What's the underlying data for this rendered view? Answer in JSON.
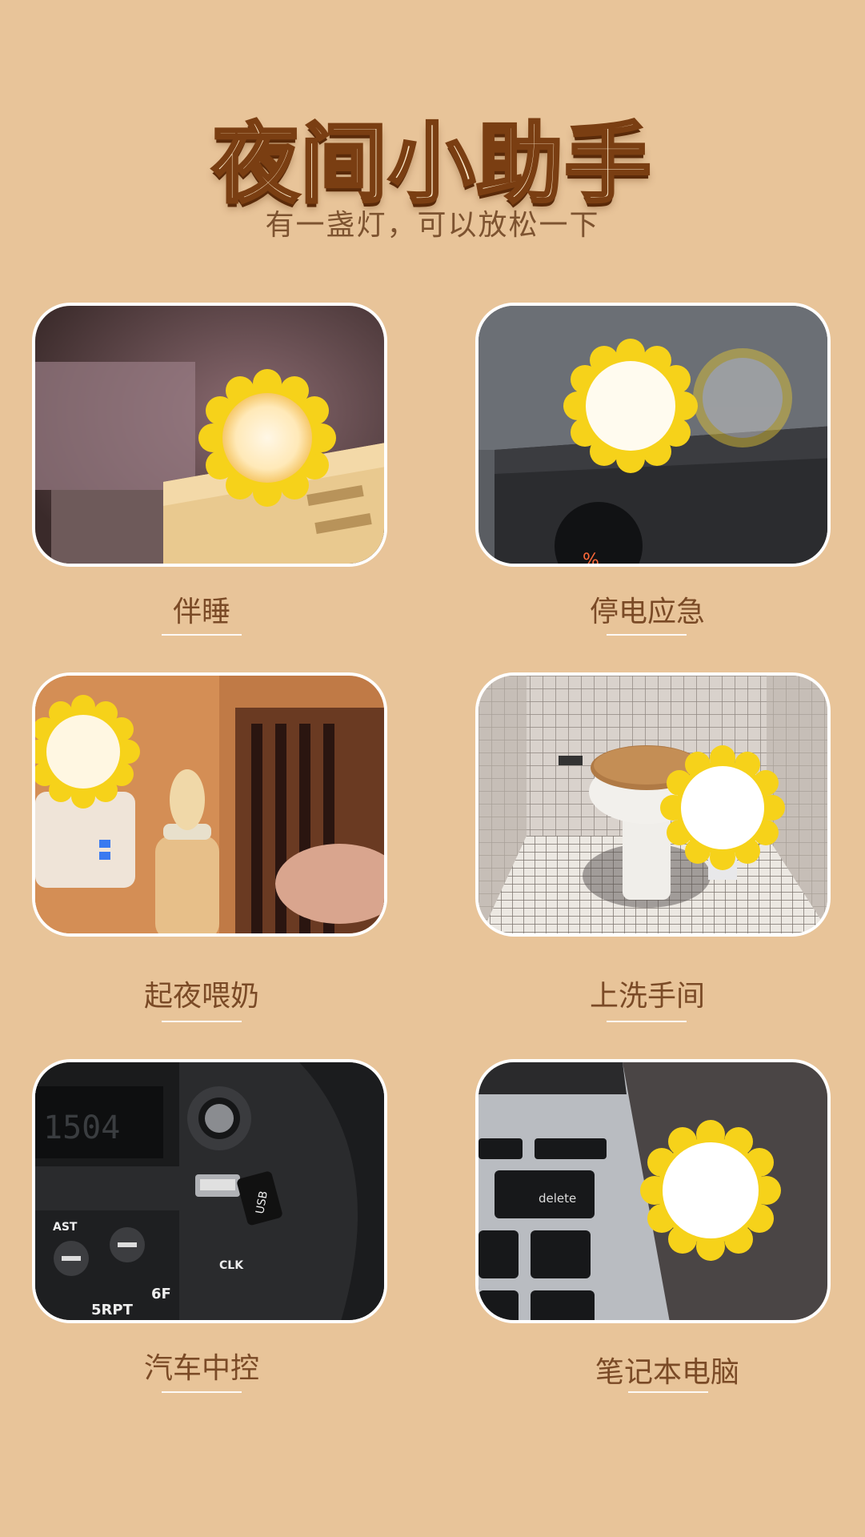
{
  "header": {
    "title": "夜间小助手",
    "subtitle": "有一盏灯，可以放松一下"
  },
  "scenes": [
    {
      "label": "伴睡"
    },
    {
      "label": "停电应急"
    },
    {
      "label": "起夜喂奶"
    },
    {
      "label": "上洗手间"
    },
    {
      "label": "汽车中控"
    },
    {
      "label": "笔记本电脑"
    }
  ],
  "images": {
    "car_panel_text": {
      "ast": "AST",
      "clk": "CLK",
      "usb": "USB",
      "btn5": "5RPT",
      "btn6": "6F"
    },
    "laptop_key": "delete"
  },
  "colors": {
    "background": "#e8c499",
    "petal": "#f6d21a",
    "title_stroke": "#7a3e12",
    "label": "#7a4a26"
  }
}
